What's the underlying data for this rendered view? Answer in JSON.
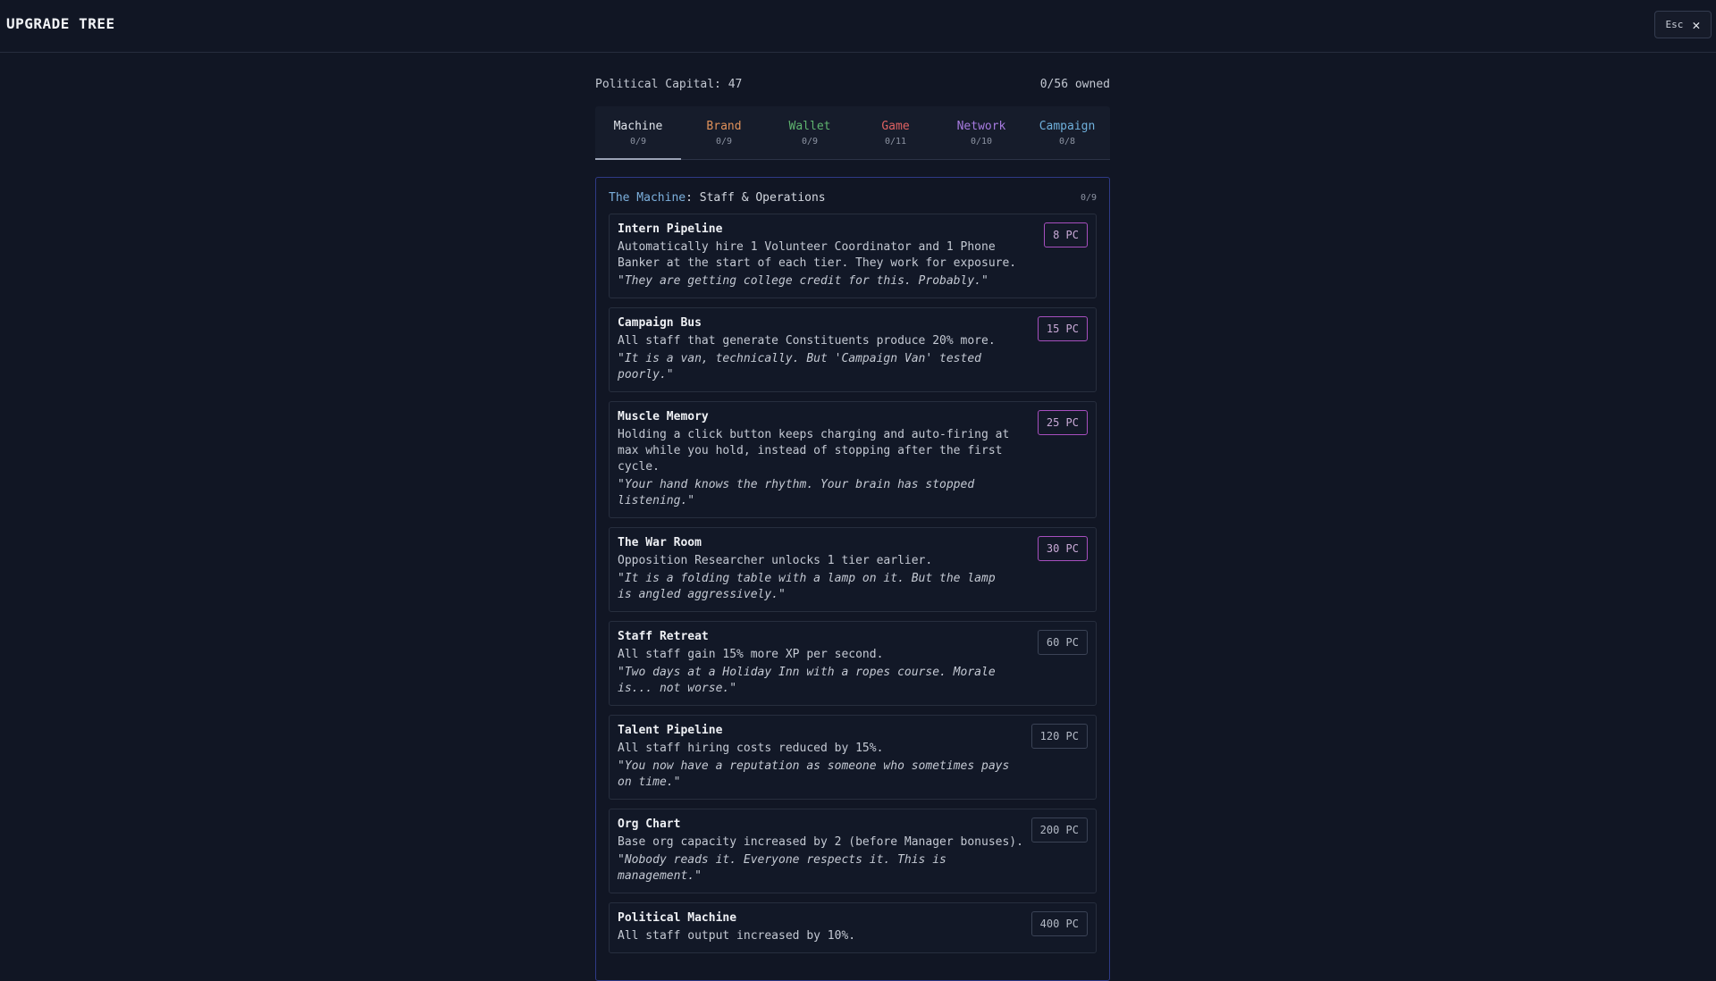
{
  "header": {
    "title": "UPGRADE TREE",
    "esc_label": "Esc",
    "close_glyph": "✕"
  },
  "status": {
    "capital_label": "Political Capital: 47",
    "owned_label": "0/56 owned"
  },
  "tabs": [
    {
      "name": "Machine",
      "count": "0/9",
      "color": "#dfe3ea"
    },
    {
      "name": "Brand",
      "count": "0/9",
      "color": "#e0915a"
    },
    {
      "name": "Wallet",
      "count": "0/9",
      "color": "#5fb56f"
    },
    {
      "name": "Game",
      "count": "0/11",
      "color": "#e06262"
    },
    {
      "name": "Network",
      "count": "0/10",
      "color": "#a77be0"
    },
    {
      "name": "Campaign",
      "count": "0/8",
      "color": "#6fb0dc"
    }
  ],
  "panel": {
    "category": "The Machine",
    "subtitle": ": Staff & Operations",
    "count": "0/9"
  },
  "upgrades": [
    {
      "name": "Intern Pipeline",
      "desc": "Automatically hire 1 Volunteer Coordinator and 1 Phone Banker at the start of each tier. They work for exposure.",
      "quote": "\"They are getting college credit for this. Probably.\"",
      "cost": "8 PC",
      "affordable": true
    },
    {
      "name": "Campaign Bus",
      "desc": "All staff that generate Constituents produce 20% more.",
      "quote": "\"It is a van, technically. But 'Campaign Van' tested poorly.\"",
      "cost": "15 PC",
      "affordable": true
    },
    {
      "name": "Muscle Memory",
      "desc": "Holding a click button keeps charging and auto-firing at max while you hold, instead of stopping after the first cycle.",
      "quote": "\"Your hand knows the rhythm. Your brain has stopped listening.\"",
      "cost": "25 PC",
      "affordable": true
    },
    {
      "name": "The War Room",
      "desc": "Opposition Researcher unlocks 1 tier earlier.",
      "quote": "\"It is a folding table with a lamp on it. But the lamp is angled aggressively.\"",
      "cost": "30 PC",
      "affordable": true
    },
    {
      "name": "Staff Retreat",
      "desc": "All staff gain 15% more XP per second.",
      "quote": "\"Two days at a Holiday Inn with a ropes course. Morale is... not worse.\"",
      "cost": "60 PC",
      "affordable": false
    },
    {
      "name": "Talent Pipeline",
      "desc": "All staff hiring costs reduced by 15%.",
      "quote": "\"You now have a reputation as someone who sometimes pays on time.\"",
      "cost": "120 PC",
      "affordable": false
    },
    {
      "name": "Org Chart",
      "desc": "Base org capacity increased by 2 (before Manager bonuses).",
      "quote": "\"Nobody reads it. Everyone respects it. This is management.\"",
      "cost": "200 PC",
      "affordable": false
    },
    {
      "name": "Political Machine",
      "desc": "All staff output increased by 10%.",
      "quote": "",
      "cost": "400 PC",
      "affordable": false
    }
  ]
}
